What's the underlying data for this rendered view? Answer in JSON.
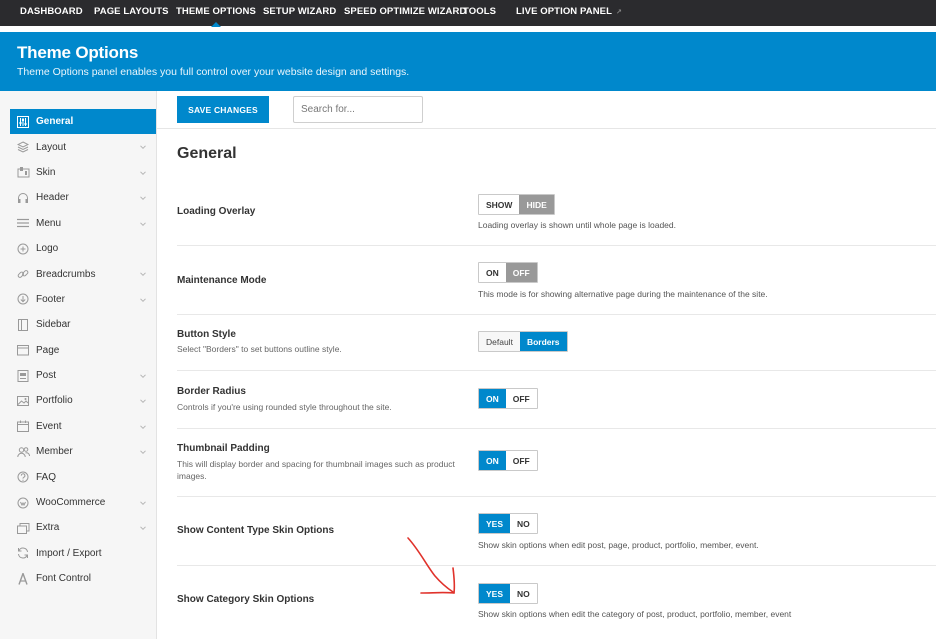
{
  "topnav": {
    "items": [
      {
        "label": "DASHBOARD"
      },
      {
        "label": "PAGE LAYOUTS"
      },
      {
        "label": "THEME OPTIONS"
      },
      {
        "label": "SETUP WIZARD"
      },
      {
        "label": "SPEED OPTIMIZE WIZARD"
      },
      {
        "label": "TOOLS"
      },
      {
        "label": "LIVE OPTION PANEL"
      }
    ],
    "active_index": 2
  },
  "hero": {
    "title": "Theme Options",
    "subtitle": "Theme Options panel enables you full control over your website design and settings."
  },
  "toolbar": {
    "save_label": "SAVE CHANGES",
    "search_placeholder": "Search for..."
  },
  "sidebar": {
    "items": [
      {
        "label": "General",
        "icon": "sliders-icon",
        "active": true
      },
      {
        "label": "Layout",
        "icon": "layers-icon"
      },
      {
        "label": "Skin",
        "icon": "palette-icon"
      },
      {
        "label": "Header",
        "icon": "headphones-icon"
      },
      {
        "label": "Menu",
        "icon": "menu-icon"
      },
      {
        "label": "Logo",
        "icon": "plus-circle-icon"
      },
      {
        "label": "Breadcrumbs",
        "icon": "link-icon"
      },
      {
        "label": "Footer",
        "icon": "arrow-down-circle-icon"
      },
      {
        "label": "Sidebar",
        "icon": "sidebar-icon"
      },
      {
        "label": "Page",
        "icon": "page-icon"
      },
      {
        "label": "Post",
        "icon": "post-icon"
      },
      {
        "label": "Portfolio",
        "icon": "image-icon"
      },
      {
        "label": "Event",
        "icon": "calendar-icon"
      },
      {
        "label": "Member",
        "icon": "users-icon"
      },
      {
        "label": "FAQ",
        "icon": "question-icon"
      },
      {
        "label": "WooCommerce",
        "icon": "woocommerce-icon"
      },
      {
        "label": "Extra",
        "icon": "extra-icon"
      },
      {
        "label": "Import / Export",
        "icon": "refresh-icon"
      },
      {
        "label": "Font Control",
        "icon": "font-icon"
      }
    ]
  },
  "main": {
    "title": "General",
    "rows": [
      {
        "label": "Loading Overlay",
        "help": "",
        "options": [
          "SHOW",
          "HIDE"
        ],
        "selected": "HIDE",
        "desc": "Loading overlay is shown until whole page is loaded."
      },
      {
        "label": "Maintenance Mode",
        "help": "",
        "options": [
          "ON",
          "OFF"
        ],
        "selected": "OFF",
        "desc": "This mode is for showing alternative page during the maintenance of the site."
      },
      {
        "label": "Button Style",
        "help": "Select \"Borders\" to set buttons outline style.",
        "options": [
          "Default",
          "Borders"
        ],
        "selected": "Borders",
        "desc": ""
      },
      {
        "label": "Border Radius",
        "help": "Controls if you're using rounded style throughout the site.",
        "options": [
          "ON",
          "OFF"
        ],
        "selected": "ON",
        "desc": ""
      },
      {
        "label": "Thumbnail Padding",
        "help": "This will display border and spacing for thumbnail images such as product images.",
        "options": [
          "ON",
          "OFF"
        ],
        "selected": "ON",
        "desc": ""
      },
      {
        "label": "Show Content Type Skin Options",
        "help": "",
        "options": [
          "YES",
          "NO"
        ],
        "selected": "YES",
        "desc": "Show skin options when edit post, page, product, portfolio, member, event."
      },
      {
        "label": "Show Category Skin Options",
        "help": "",
        "options": [
          "YES",
          "NO"
        ],
        "selected": "YES",
        "desc": "Show skin options when edit the category of post, product, portfolio, member, event"
      }
    ]
  },
  "colors": {
    "accent": "#0088cc",
    "topnav_bg": "#2b2b2e",
    "annotation_arrow": "#e0322b"
  }
}
